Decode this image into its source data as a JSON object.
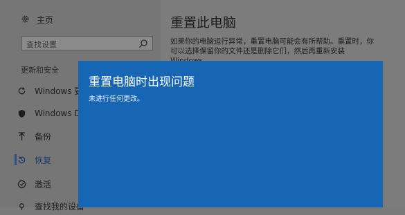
{
  "sidebar": {
    "home_label": "主页",
    "search_placeholder": "查找设置",
    "section_title": "更新和安全",
    "items": [
      {
        "label": "Windows 更新",
        "icon": "refresh-icon"
      },
      {
        "label": "Windows Defender",
        "icon": "shield-icon"
      },
      {
        "label": "备份",
        "icon": "backup-arrow-icon"
      },
      {
        "label": "恢复",
        "icon": "recovery-icon",
        "active": true
      },
      {
        "label": "激活",
        "icon": "check-circle-icon"
      },
      {
        "label": "查找我的设备",
        "icon": "find-device-icon"
      }
    ]
  },
  "main": {
    "title": "重置此电脑",
    "description": "如果你的电脑运行异常，重置电脑可能会有所帮助。重置时，你可以选择保留你的文件还是删除它们，然后再重新安装 Windows。"
  },
  "dialog": {
    "title": "重置电脑时出现问题",
    "message": "未进行任何更改。"
  },
  "colors": {
    "dialog_bg": "#1766b4",
    "active_accent": "#2d4f87"
  }
}
